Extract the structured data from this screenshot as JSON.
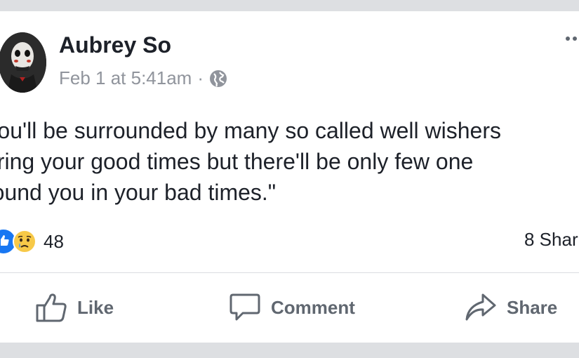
{
  "post": {
    "author": "Aubrey So",
    "timestamp": "Feb 1 at 5:41am",
    "separator": "·",
    "privacy_icon": "globe-icon",
    "text_lines": [
      "You'll be surrounded by many so called well wishers",
      "uring your good times but there'll be only few one",
      "round you in your bad times.\""
    ]
  },
  "stats": {
    "reaction_icons": [
      "like-reaction-icon",
      "sad-reaction-icon"
    ],
    "reaction_count": "48",
    "shares": "8 Shar"
  },
  "actions": {
    "like_label": "Like",
    "comment_label": "Comment",
    "share_label": "Share"
  },
  "colors": {
    "background": "#dddfe2",
    "card": "#ffffff",
    "primary_text": "#1d2129",
    "secondary_text": "#90949c",
    "action_text": "#606770",
    "like_blue": "#1877f2",
    "sad_yellow": "#f7c948"
  }
}
